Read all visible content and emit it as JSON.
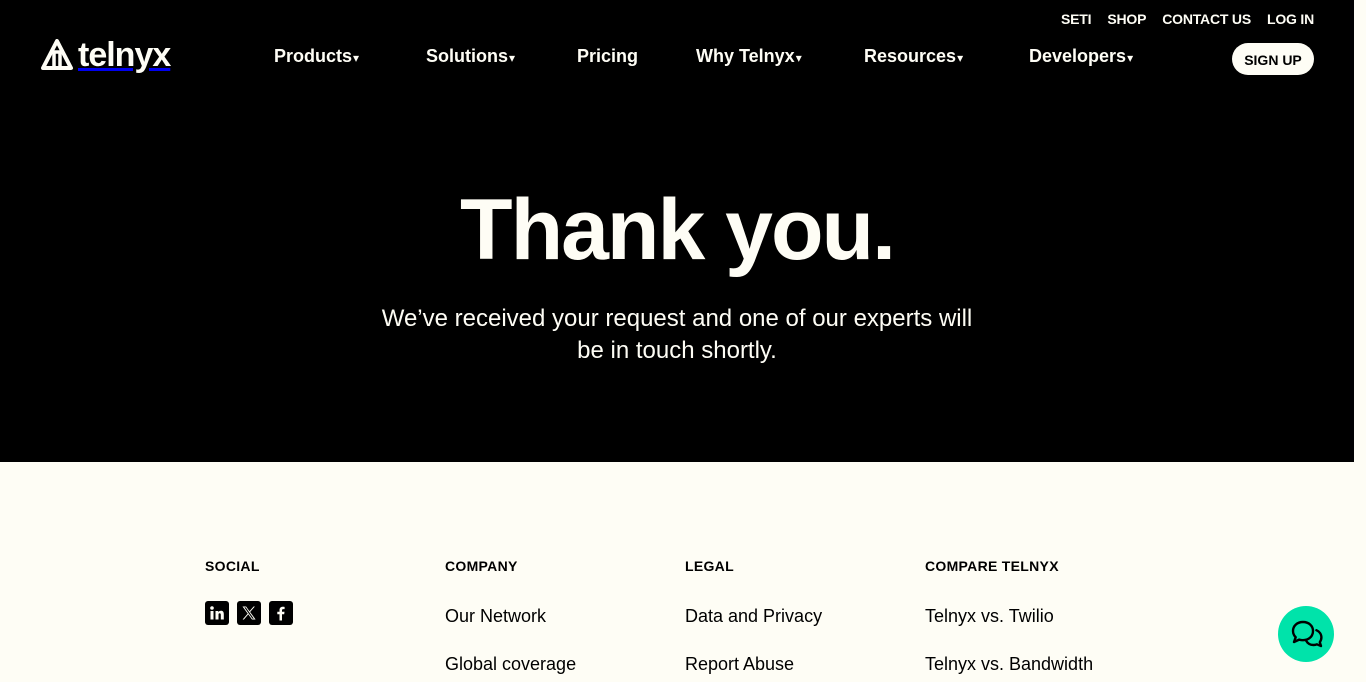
{
  "header": {
    "logo_text": "telnyx",
    "utility_links": [
      "SETI",
      "SHOP",
      "CONTACT US",
      "LOG IN"
    ],
    "main_nav": [
      {
        "label": "Products",
        "has_dropdown": true
      },
      {
        "label": "Solutions",
        "has_dropdown": true
      },
      {
        "label": "Pricing",
        "has_dropdown": false
      },
      {
        "label": "Why Telnyx",
        "has_dropdown": true
      },
      {
        "label": "Resources",
        "has_dropdown": true
      },
      {
        "label": "Developers",
        "has_dropdown": true
      }
    ],
    "caret": "▾",
    "signup_label": "SIGN UP"
  },
  "hero": {
    "title": "Thank you.",
    "message": "We’ve received your request and one of our experts will be in touch shortly."
  },
  "footer": {
    "social": {
      "heading": "SOCIAL",
      "icons": [
        "linkedin-icon",
        "x-icon",
        "facebook-icon"
      ]
    },
    "company": {
      "heading": "COMPANY",
      "links": [
        "Our Network",
        "Global coverage"
      ]
    },
    "legal": {
      "heading": "LEGAL",
      "links": [
        "Data and Privacy",
        "Report Abuse"
      ]
    },
    "compare": {
      "heading": "COMPARE TELNYX",
      "links": [
        "Telnyx vs. Twilio",
        "Telnyx vs. Bandwidth"
      ]
    }
  },
  "colors": {
    "hero_bg": "#000000",
    "cream": "#fefdf5",
    "chat_accent": "#00e3aa"
  },
  "chat_icon": "chat-bubbles-icon"
}
